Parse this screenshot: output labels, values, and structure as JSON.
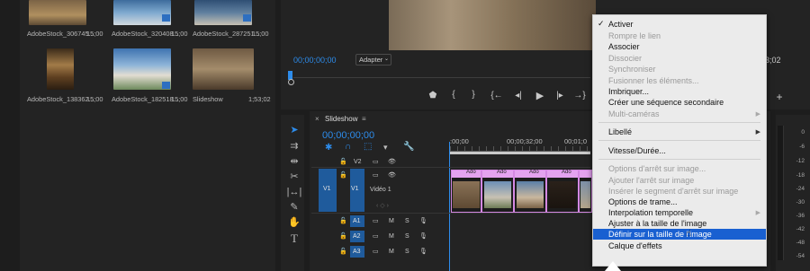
{
  "project": {
    "items": [
      {
        "name": "AdobeStock_306745...",
        "dur": "15;00"
      },
      {
        "name": "AdobeStock_320408...",
        "dur": "15;00"
      },
      {
        "name": "AdobeStock_287251...",
        "dur": "15;00"
      },
      {
        "name": "AdobeStock_138362...",
        "dur": "15;00"
      },
      {
        "name": "AdobeStock_182518...",
        "dur": "15;00"
      },
      {
        "name": "Slideshow",
        "dur": "1;53;02"
      }
    ]
  },
  "program": {
    "timecode": "00;00;00;00",
    "fit_label": "Adapter",
    "end_timecode": "3;02"
  },
  "timeline": {
    "tab_label": "Slideshow",
    "timecode": "00;00;00;00",
    "ruler": [
      ":00;00",
      "00;00;32;00",
      "00;01;0"
    ],
    "tracks": {
      "v2": "V2",
      "v1_src": "V1",
      "v1": "V1",
      "v1_name": "Vidéo 1",
      "a1": "A1",
      "a2": "A2",
      "a3": "A3",
      "mute": "M",
      "solo": "S"
    },
    "clip_label": "Ado"
  },
  "meter": {
    "scale": [
      "0",
      "-6",
      "-12",
      "-18",
      "-24",
      "-30",
      "-36",
      "-42",
      "-48",
      "-54"
    ]
  },
  "context_menu": {
    "items": [
      {
        "label": "Activer",
        "state": "checked"
      },
      {
        "label": "Rompre le lien",
        "state": "disabled"
      },
      {
        "label": "Associer",
        "state": "enabled"
      },
      {
        "label": "Dissocier",
        "state": "disabled"
      },
      {
        "label": "Synchroniser",
        "state": "disabled"
      },
      {
        "label": "Fusionner les éléments...",
        "state": "disabled"
      },
      {
        "label": "Imbriquer...",
        "state": "enabled"
      },
      {
        "label": "Créer une séquence secondaire",
        "state": "enabled"
      },
      {
        "label": "Multi-caméras",
        "state": "disabled"
      },
      {
        "label": "Libellé",
        "state": "enabled"
      },
      {
        "label": "Vitesse/Durée...",
        "state": "enabled"
      },
      {
        "label": "Options d'arrêt sur image...",
        "state": "disabled"
      },
      {
        "label": "Ajouter l'arrêt sur image",
        "state": "disabled"
      },
      {
        "label": "Insérer le segment d'arrêt sur image",
        "state": "disabled"
      },
      {
        "label": "Options de trame...",
        "state": "enabled"
      },
      {
        "label": "Interpolation temporelle",
        "state": "enabled"
      },
      {
        "label": "Ajuster à la taille de l'image",
        "state": "enabled"
      },
      {
        "label": "Définir sur la taille de l'image",
        "state": "highlighted"
      },
      {
        "label": "Calque d'effets",
        "state": "enabled"
      }
    ]
  },
  "colors": {
    "accent": "#2d8ceb",
    "menu_highlight": "#1960d1",
    "clip": "#e4a3ef"
  }
}
